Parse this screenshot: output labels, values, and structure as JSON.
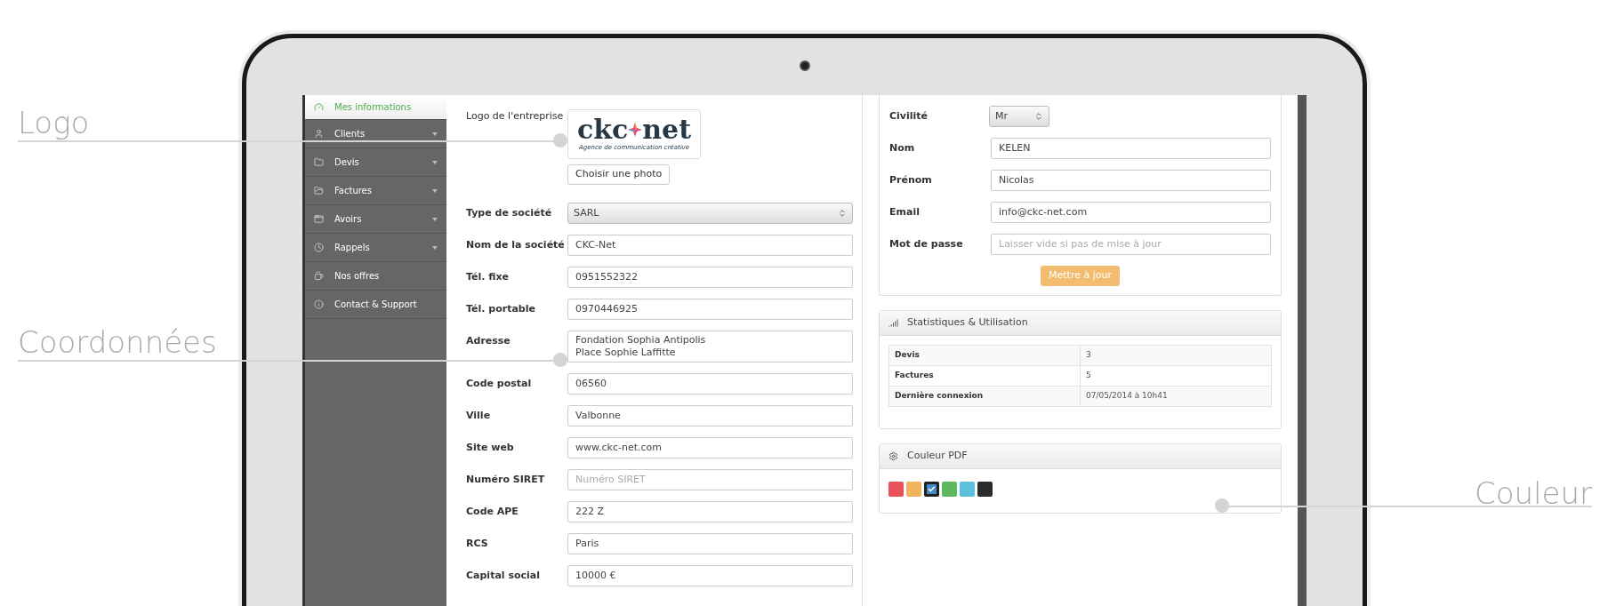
{
  "callouts": [
    {
      "label": "Logo"
    },
    {
      "label": "Coordonnées"
    },
    {
      "label": "Couleur"
    }
  ],
  "sidebar": {
    "items": [
      {
        "label": "Mes informations",
        "selected": true,
        "dropdown": false
      },
      {
        "label": "Clients",
        "selected": false,
        "dropdown": true
      },
      {
        "label": "Devis",
        "selected": false,
        "dropdown": true
      },
      {
        "label": "Factures",
        "selected": false,
        "dropdown": true
      },
      {
        "label": "Avoirs",
        "selected": false,
        "dropdown": true
      },
      {
        "label": "Rappels",
        "selected": false,
        "dropdown": true
      },
      {
        "label": "Nos offres",
        "selected": false,
        "dropdown": false
      },
      {
        "label": "Contact & Support",
        "selected": false,
        "dropdown": false
      }
    ]
  },
  "company": {
    "logo_label": "Logo de l'entreprise",
    "logo": {
      "left": "ckc",
      "right": "net",
      "tagline": "Agence de communication créative"
    },
    "photo_button": "Choisir une photo",
    "fields": [
      {
        "kind": "select",
        "label": "Type de société",
        "value": "SARL"
      },
      {
        "kind": "input",
        "label": "Nom de la société",
        "value": "CKC-Net"
      },
      {
        "kind": "input",
        "label": "Tél. fixe",
        "value": "0951552322"
      },
      {
        "kind": "input",
        "label": "Tél. portable",
        "value": "0970446925"
      },
      {
        "kind": "textarea",
        "label": "Adresse",
        "value": "Fondation Sophia Antipolis\nPlace Sophie Laffitte"
      },
      {
        "kind": "input",
        "label": "Code postal",
        "value": "06560"
      },
      {
        "kind": "input",
        "label": "Ville",
        "value": "Valbonne"
      },
      {
        "kind": "input",
        "label": "Site web",
        "value": "www.ckc-net.com"
      },
      {
        "kind": "input",
        "label": "Numéro SIRET",
        "placeholder": "Numéro SIRET"
      },
      {
        "kind": "input",
        "label": "Code APE",
        "value": "222 Z"
      },
      {
        "kind": "input",
        "label": "RCS",
        "value": "Paris"
      },
      {
        "kind": "input",
        "label": "Capital social",
        "value": "10000 €"
      }
    ]
  },
  "profile": {
    "fields": [
      {
        "kind": "select",
        "label": "Civilité",
        "value": "Mr"
      },
      {
        "kind": "input",
        "label": "Nom",
        "value": "KELEN"
      },
      {
        "kind": "input",
        "label": "Prénom",
        "value": "Nicolas"
      },
      {
        "kind": "input",
        "label": "Email",
        "value": "info@ckc-net.com"
      },
      {
        "kind": "input",
        "label": "Mot de passe",
        "placeholder": "Laisser vide si pas de mise à jour"
      }
    ],
    "submit": "Mettre à jour"
  },
  "stats": {
    "title": "Statistiques & Utilisation",
    "rows": [
      {
        "label": "Devis",
        "value": "3"
      },
      {
        "label": "Factures",
        "value": "5"
      },
      {
        "label": "Dernière connexion",
        "value": "07/05/2014 à 10h41"
      }
    ]
  },
  "pdf_color": {
    "title": "Couleur PDF",
    "swatches": [
      {
        "color": "#e9525a",
        "selected": false
      },
      {
        "color": "#f1b45e",
        "selected": false
      },
      {
        "color": "#428bca",
        "selected": true
      },
      {
        "color": "#5cb85c",
        "selected": false
      },
      {
        "color": "#5bc0de",
        "selected": false
      },
      {
        "color": "#2b2b2b",
        "selected": false
      }
    ]
  }
}
